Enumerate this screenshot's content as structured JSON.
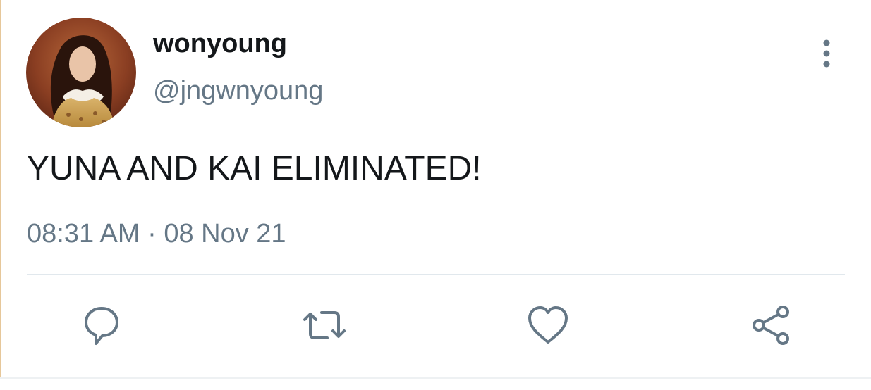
{
  "tweet": {
    "display_name": "wonyoung",
    "handle": "@jngwnyoung",
    "text": "YUNA AND KAI ELIMINATED!",
    "timestamp": "08:31 AM · 08 Nov 21"
  },
  "actions": {
    "reply_icon": "reply-icon",
    "retweet_icon": "retweet-icon",
    "like_icon": "heart-icon",
    "share_icon": "share-icon",
    "more_icon": "more-vertical-icon"
  },
  "colors": {
    "text": "#14171a",
    "secondary": "#657786",
    "divider": "#e1e8ed"
  }
}
